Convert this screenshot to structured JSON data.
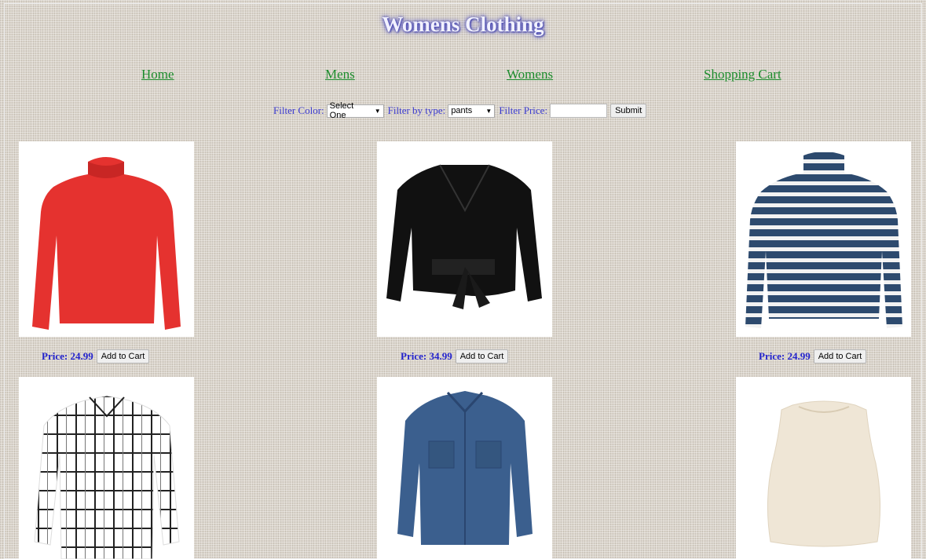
{
  "page": {
    "title": "Womens Clothing"
  },
  "nav": {
    "home": "Home",
    "mens": "Mens",
    "womens": "Womens",
    "cart": "Shopping Cart"
  },
  "filters": {
    "color_label": "Filter Color:",
    "color_value": "Select One",
    "type_label": "Filter by type:",
    "type_value": "pants",
    "price_label": "Filter Price:",
    "price_value": "",
    "submit_label": "Submit"
  },
  "products": [
    {
      "name": "red-turtleneck",
      "color": "#e5322f",
      "price": "Price: 24.99",
      "button": "Add to Cart"
    },
    {
      "name": "black-wrap-top",
      "color": "#111111",
      "price": "Price: 34.99",
      "button": "Add to Cart"
    },
    {
      "name": "striped-turtleneck",
      "color": "#2d4a6e",
      "price": "Price: 24.99",
      "button": "Add to Cart"
    },
    {
      "name": "plaid-shirt",
      "color": "#ffffff"
    },
    {
      "name": "denim-shirt",
      "color": "#3b5f8e"
    },
    {
      "name": "cream-blouse",
      "color": "#efe6d6"
    }
  ]
}
